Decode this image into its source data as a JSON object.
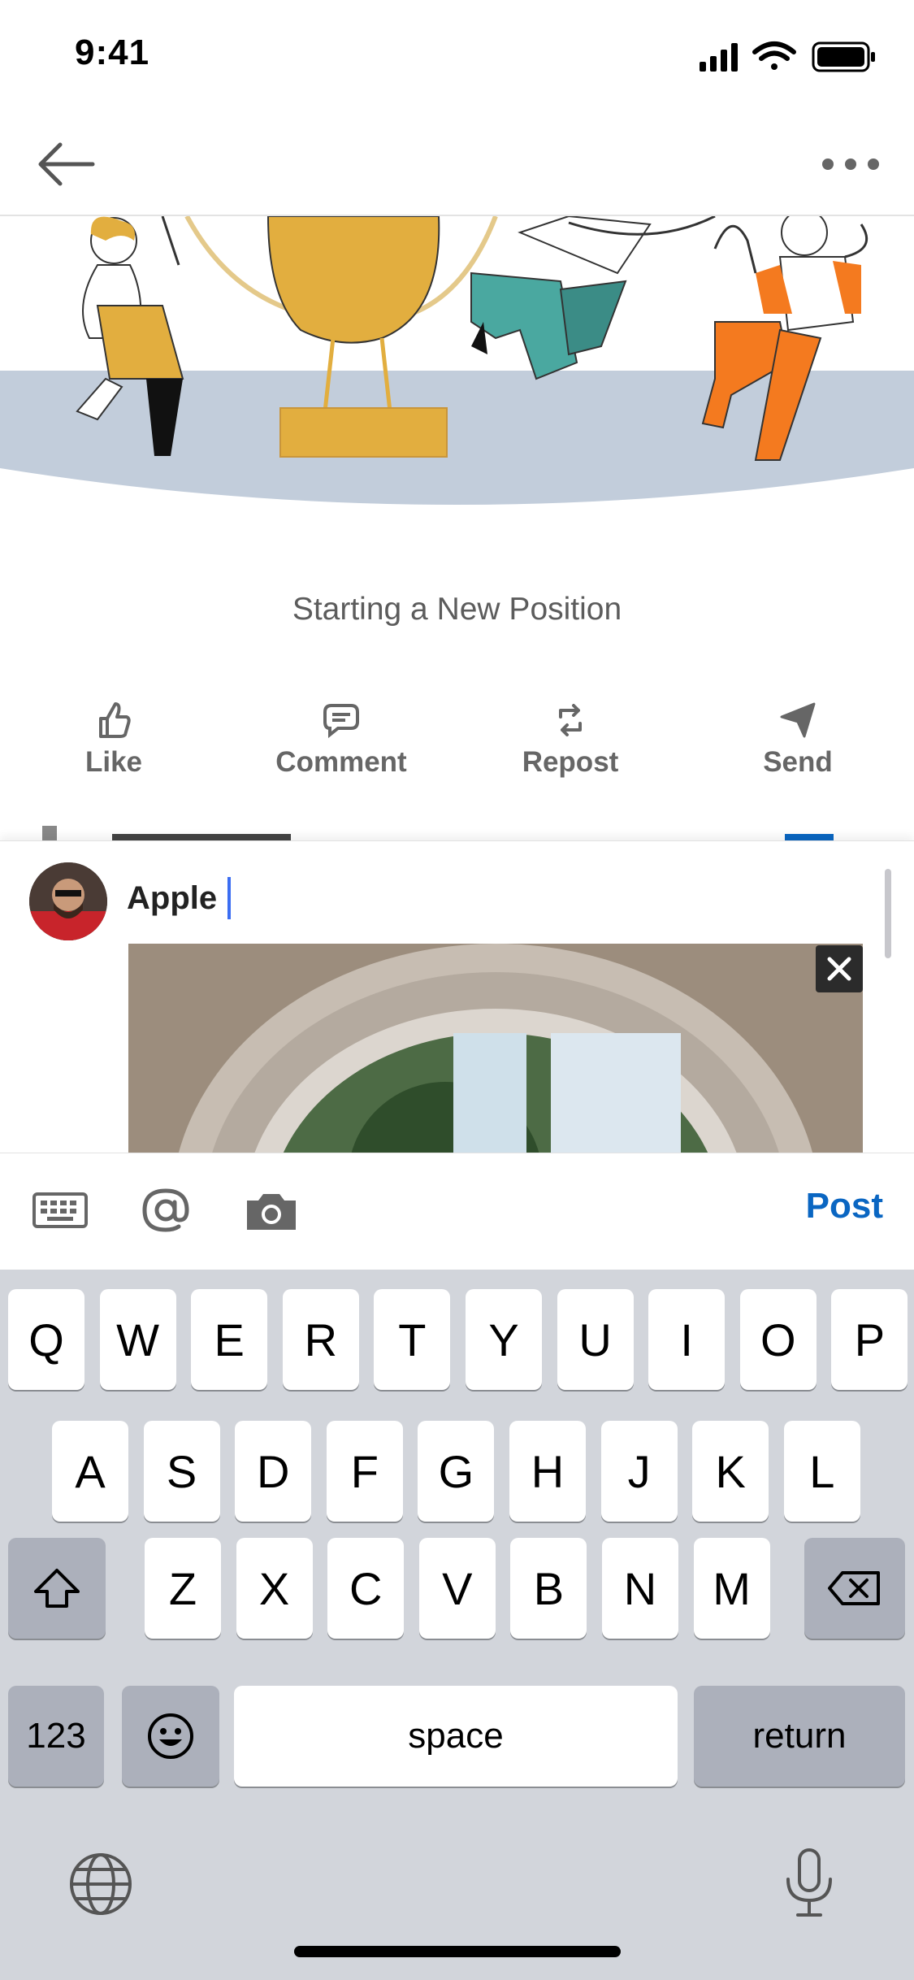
{
  "status_bar": {
    "time": "9:41"
  },
  "post": {
    "title": "Starting a New Position"
  },
  "actions": [
    {
      "label": "Like",
      "icon": "thumbs-up-icon"
    },
    {
      "label": "Comment",
      "icon": "comment-bubble-icon"
    },
    {
      "label": "Repost",
      "icon": "repost-icon"
    },
    {
      "label": "Send",
      "icon": "send-paper-plane-icon"
    }
  ],
  "composer": {
    "text": "Apple"
  },
  "toolbar": {
    "post_label": "Post"
  },
  "keyboard": {
    "row1": [
      "Q",
      "W",
      "E",
      "R",
      "T",
      "Y",
      "U",
      "I",
      "O",
      "P"
    ],
    "row2": [
      "A",
      "S",
      "D",
      "F",
      "G",
      "H",
      "J",
      "K",
      "L"
    ],
    "row3": [
      "Z",
      "X",
      "C",
      "V",
      "B",
      "N",
      "M"
    ],
    "numbers_label": "123",
    "space_label": "space",
    "return_label": "return"
  },
  "colors": {
    "accent": "#0a66c2",
    "caret": "#3b6df2",
    "keyboard_bg": "#d2d5db"
  }
}
